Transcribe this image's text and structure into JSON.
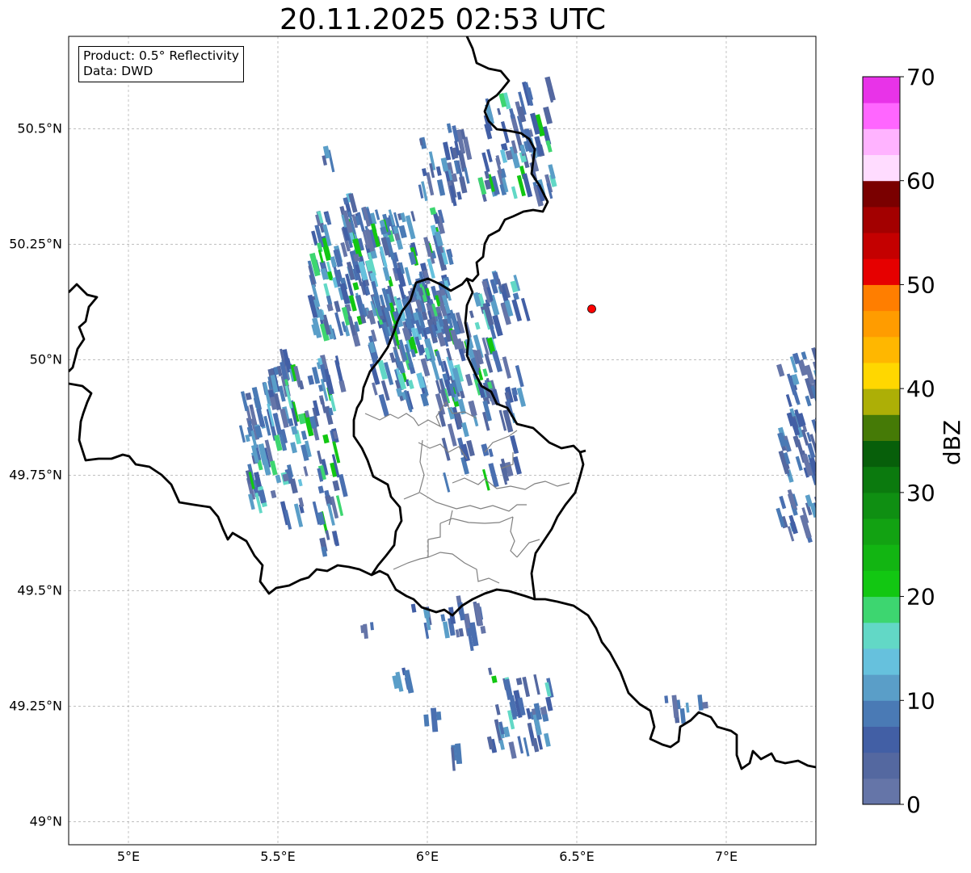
{
  "title": "20.11.2025 02:53 UTC",
  "info": {
    "product": "Product: 0.5° Reflectivity",
    "data_source": "Data: DWD"
  },
  "map": {
    "lon_range": [
      4.8,
      7.3
    ],
    "lat_range": [
      48.95,
      50.7
    ],
    "lon_ticks": [
      {
        "value": 5.0,
        "label": "5°E"
      },
      {
        "value": 5.5,
        "label": "5.5°E"
      },
      {
        "value": 6.0,
        "label": "6°E"
      },
      {
        "value": 6.5,
        "label": "6.5°E"
      },
      {
        "value": 7.0,
        "label": "7°E"
      }
    ],
    "lat_ticks": [
      {
        "value": 49.0,
        "label": "49°N"
      },
      {
        "value": 49.25,
        "label": "49.25°N"
      },
      {
        "value": 49.5,
        "label": "49.5°N"
      },
      {
        "value": 49.75,
        "label": "49.75°N"
      },
      {
        "value": 50.0,
        "label": "50°N"
      },
      {
        "value": 50.25,
        "label": "50.25°N"
      },
      {
        "value": 50.5,
        "label": "50.5°N"
      }
    ],
    "radar_site": {
      "lon": 6.55,
      "lat": 50.11,
      "color": "#ff0000"
    }
  },
  "colorbar": {
    "label": "dBZ",
    "min": 0,
    "max": 70,
    "step": 2.5,
    "ticks": [
      {
        "value": 0,
        "label": "0"
      },
      {
        "value": 10,
        "label": "10"
      },
      {
        "value": 20,
        "label": "20"
      },
      {
        "value": 30,
        "label": "30"
      },
      {
        "value": 40,
        "label": "40"
      },
      {
        "value": 50,
        "label": "50"
      },
      {
        "value": 60,
        "label": "60"
      },
      {
        "value": 70,
        "label": "70"
      }
    ],
    "colors": [
      "#6575a8",
      "#5468a0",
      "#425fa5",
      "#4a7ab5",
      "#5a9ec8",
      "#66c1dd",
      "#62d8c6",
      "#3dd670",
      "#12c712",
      "#12b512",
      "#12a212",
      "#0f8f12",
      "#0b7a0e",
      "#075f0a",
      "#457a06",
      "#adaf06",
      "#ffd700",
      "#ffb700",
      "#ff9c00",
      "#ff7e00",
      "#e60000",
      "#c40000",
      "#a30000",
      "#7a0000",
      "#ffdcff",
      "#ffb3ff",
      "#ff66ff",
      "#e833e8"
    ]
  }
}
